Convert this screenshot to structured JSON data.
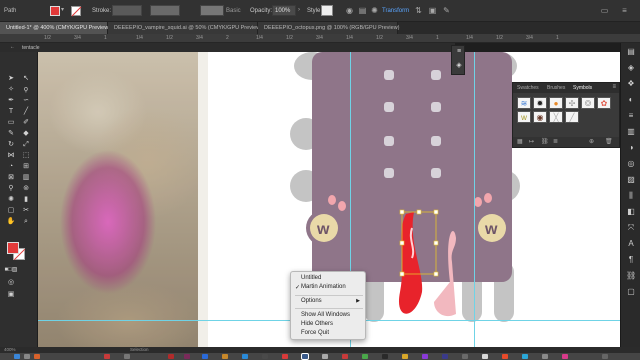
{
  "control_bar": {
    "object_type": "Path",
    "stroke_label": "Stroke:",
    "brush_style": "Basic",
    "opacity_label": "Opacity:",
    "opacity_value": "100%",
    "style_label": "Style",
    "transform_label": "Transform",
    "fill_color": "#e23a3a"
  },
  "tabs": [
    {
      "label": "Untitled-1* @ 400% (CMYK/GPU Preview)",
      "active": true
    },
    {
      "label": "DEEEEPIO_vampire_squid.ai @ 50% (CMYK/GPU Preview)",
      "active": false
    },
    {
      "label": "DEEEEPIO_octopus.png @ 100% (RGB/GPU Preview)",
      "active": false
    }
  ],
  "ruler_ticks": [
    "1/2",
    "3/4",
    "1",
    "1/4",
    "1/2",
    "3/4",
    "2",
    "1/4",
    "1/2",
    "3/4",
    "1/4",
    "1/2",
    "3/4",
    "1",
    "1/4",
    "1/2",
    "3/4",
    "1"
  ],
  "breadcrumb": {
    "back": "←",
    "layer_name": "tentacle"
  },
  "panel": {
    "tabs": [
      "Swatches",
      "Brushes",
      "Symbols"
    ],
    "active_tab": "Symbols",
    "menu_icon": "≡"
  },
  "context_menu": {
    "items": [
      "Untitled",
      "Martin Animation",
      "Options",
      "Show All Windows",
      "Hide Others",
      "Force Quit"
    ],
    "checked": "Martin Animation"
  },
  "character": {
    "face_left_letter": "w",
    "face_right_letter": "w",
    "body_color": "#8f7589",
    "ear_color": "#c4c4c4",
    "tentacle_colors": [
      "#e8232b",
      "#f2b8bf"
    ]
  },
  "status_bar": {
    "zoom": "400%",
    "tool": "Selection"
  },
  "icons": {
    "tools": [
      "selection-arrow",
      "direct-selection",
      "magic-wand",
      "lasso",
      "pen",
      "curvature",
      "type",
      "line",
      "rectangle",
      "paintbrush",
      "pencil",
      "eraser",
      "rotate",
      "scale",
      "width",
      "free-transform",
      "shape-builder",
      "perspective",
      "mesh",
      "gradient",
      "eyedropper",
      "blend",
      "symbol-sprayer",
      "graph",
      "artboard",
      "slice",
      "hand",
      "zoom"
    ],
    "dock_right": [
      "properties",
      "layers",
      "libraries",
      "color",
      "stroke",
      "gradient",
      "transparency",
      "appearance",
      "graphic-styles",
      "align",
      "pathfinder",
      "transform",
      "character",
      "paragraph",
      "links",
      "artboards"
    ]
  }
}
